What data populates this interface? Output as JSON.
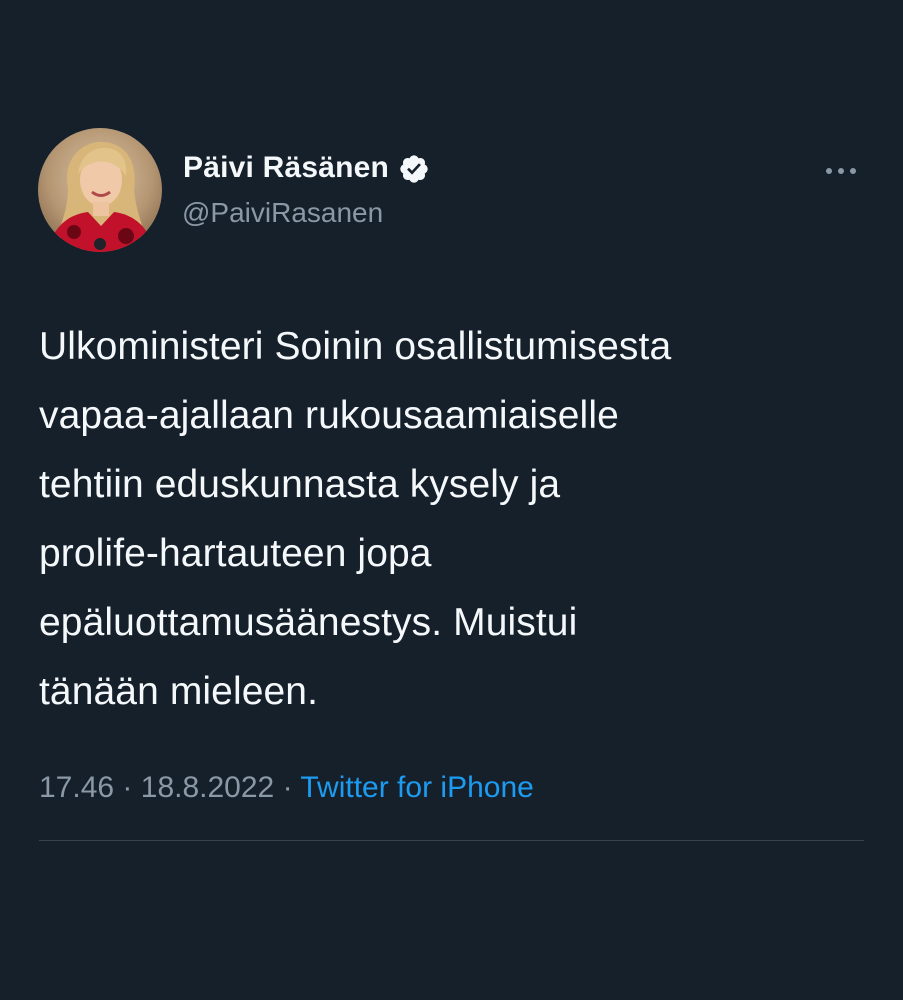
{
  "author": {
    "display_name": "Päivi Räsänen",
    "handle": "@PaiviRasanen",
    "verified": true,
    "avatar_icon": "profile-photo"
  },
  "tweet": {
    "text": "Ulkoministeri Soinin osallistumisesta\nvapaa-ajallaan rukousaamiaiselle\ntehtiin eduskunnasta kysely ja\nprolife-hartauteen jopa\nepäluottamusäänestys. Muistui\ntänään mieleen.",
    "time": "17.46",
    "separator": "·",
    "date": "18.8.2022",
    "source": "Twitter for iPhone"
  },
  "icons": {
    "more": "more-options-icon",
    "verified": "verified-badge-icon"
  },
  "colors": {
    "background": "#15202b",
    "text": "#f5f8fa",
    "secondary": "#8b98a5",
    "accent": "#1d9bf0",
    "divider": "#38444d"
  }
}
